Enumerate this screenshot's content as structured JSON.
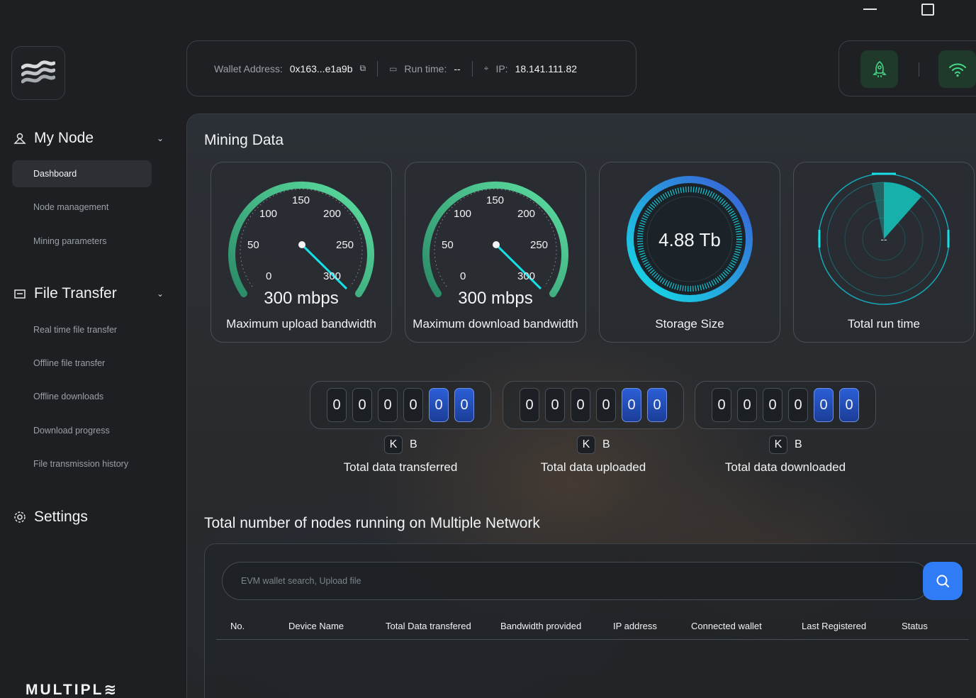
{
  "window": {
    "minimize_icon": "minimize-icon",
    "maximize_icon": "maximize-icon"
  },
  "sidebar": {
    "logo_icon": "multiple-wave-logo",
    "sections": [
      {
        "label": "My Node",
        "icon": "node-icon",
        "items": [
          "Dashboard",
          "Node management",
          "Mining parameters"
        ]
      },
      {
        "label": "File Transfer",
        "icon": "folder-icon",
        "items": [
          "Real time file transfer",
          "Offline file transfer",
          "Offline downloads",
          "Download progress",
          "File transmission history"
        ]
      },
      {
        "label": "Settings",
        "icon": "gear-icon",
        "items": []
      }
    ],
    "active_item": "Dashboard",
    "brand": "MULTIPL"
  },
  "header": {
    "wallet_label": "Wallet Address:",
    "wallet_value": "0x163...e1a9b",
    "runtime_label": "Run time:",
    "runtime_value": "--",
    "ip_label": "IP:",
    "ip_value": "18.141.111.82"
  },
  "main": {
    "mining_title": "Mining Data",
    "cards": [
      {
        "value": "300 mbps",
        "caption": "Maximum upload bandwidth",
        "ticks": [
          "0",
          "50",
          "100",
          "150",
          "200",
          "250",
          "300"
        ]
      },
      {
        "value": "300 mbps",
        "caption": "Maximum download bandwidth",
        "ticks": [
          "0",
          "50",
          "100",
          "150",
          "200",
          "250",
          "300"
        ]
      },
      {
        "value": "4.88 Tb",
        "caption": "Storage Size"
      },
      {
        "value": "--",
        "caption": "Total run time"
      }
    ],
    "counters": [
      {
        "digits": [
          "0",
          "0",
          "0",
          "0",
          "0",
          "0"
        ],
        "unit_k": "K",
        "unit_b": "B",
        "caption": "Total data transferred"
      },
      {
        "digits": [
          "0",
          "0",
          "0",
          "0",
          "0",
          "0"
        ],
        "unit_k": "K",
        "unit_b": "B",
        "caption": "Total data uploaded"
      },
      {
        "digits": [
          "0",
          "0",
          "0",
          "0",
          "0",
          "0"
        ],
        "unit_k": "K",
        "unit_b": "B",
        "caption": "Total data downloaded"
      }
    ],
    "nodes_title": "Total number of nodes running on Multiple Network",
    "search_placeholder": "EVM wallet search, Upload file",
    "columns": [
      "No.",
      "Device Name",
      "Total Data transfered",
      "Bandwidth provided",
      "IP address",
      "Connected wallet",
      "Last Registered",
      "Status"
    ]
  },
  "colors": {
    "accent_green": "#3fd08a",
    "accent_cyan": "#14e0e6",
    "accent_blue": "#2f7cf6"
  }
}
